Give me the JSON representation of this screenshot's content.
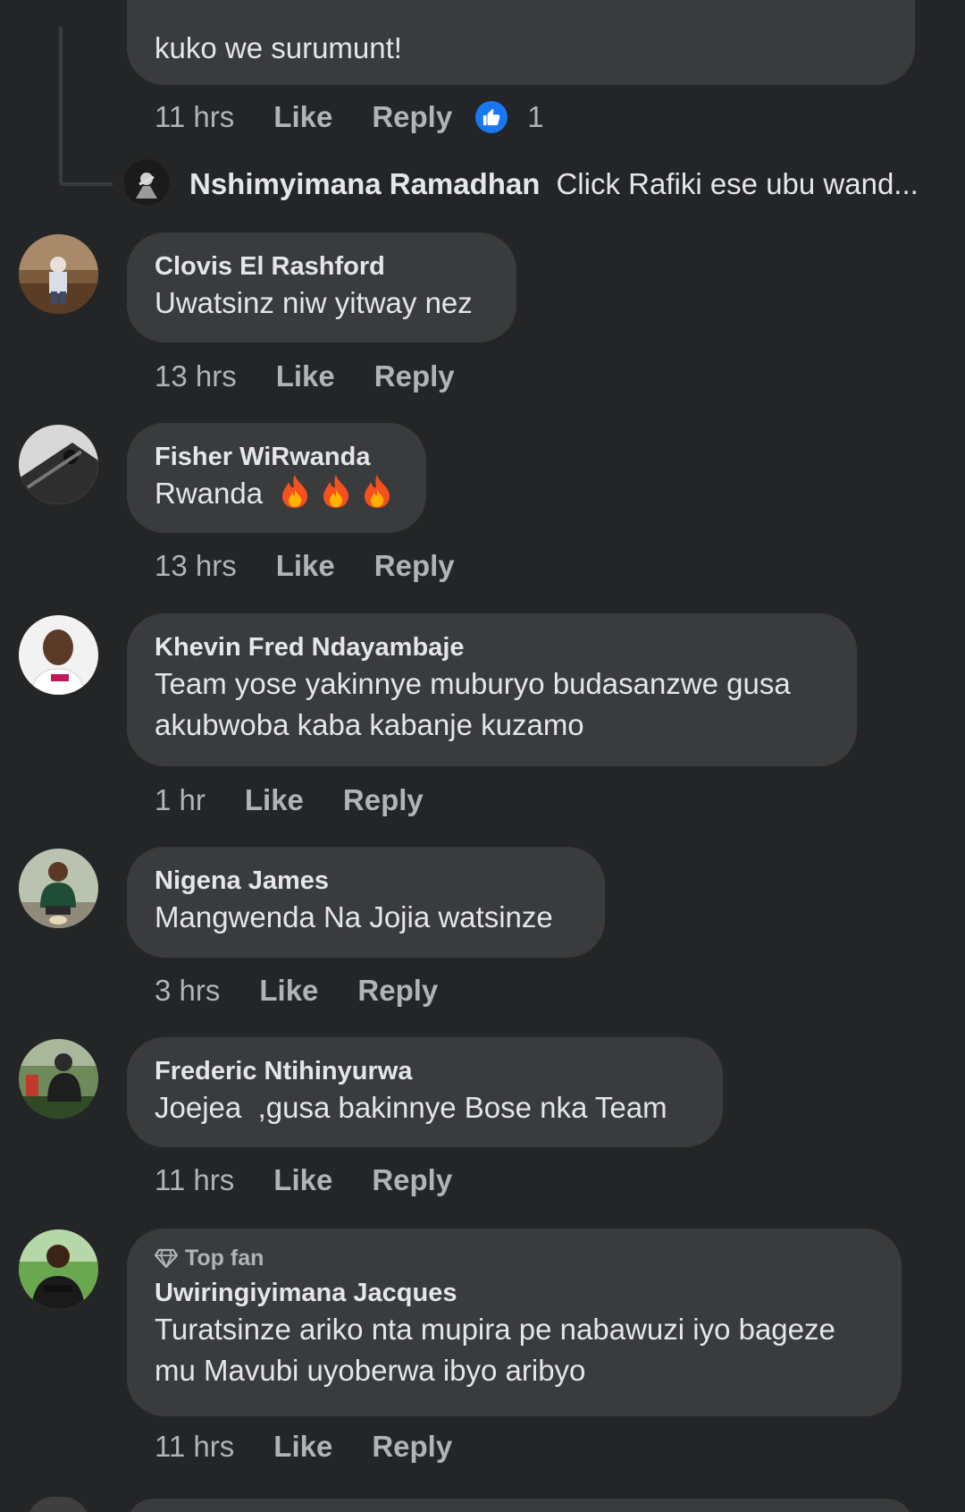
{
  "top_reply": {
    "text": "kuko we surumunt!",
    "time": "11 hrs",
    "like": "Like",
    "reply": "Reply",
    "reaction_count": "1"
  },
  "reply_preview": {
    "author": "Nshimyimana Ramadhan",
    "text": "Click Rafiki ese ubu wand..."
  },
  "comments": [
    {
      "author": "Clovis El Rashford",
      "text": "Uwatsinz niw yitway nez",
      "time": "13 hrs",
      "like": "Like",
      "reply": "Reply"
    },
    {
      "author": "Fisher WiRwanda",
      "text": "Rwanda",
      "emoji": [
        "fire-icon",
        "fire-icon",
        "fire-icon"
      ],
      "time": "13 hrs",
      "like": "Like",
      "reply": "Reply"
    },
    {
      "author": "Khevin Fred Ndayambaje",
      "text_line1": "Team yose yakinnye muburyo budasanzwe gusa",
      "text_line2": "akubwoba kaba kabanje kuzamo",
      "time": "1 hr",
      "like": "Like",
      "reply": "Reply"
    },
    {
      "author": "Nigena James",
      "text": "Mangwenda Na Jojia watsinze",
      "time": "3 hrs",
      "like": "Like",
      "reply": "Reply"
    },
    {
      "author": "Frederic Ntihinyurwa",
      "text": "Joejea  ,gusa bakinnye Bose nka Team",
      "time": "11 hrs",
      "like": "Like",
      "reply": "Reply"
    },
    {
      "badge": "Top fan",
      "author": "Uwiringiyimana Jacques",
      "text_line1": "Turatsinze ariko nta mupira pe nabawuzi iyo bageze",
      "text_line2": "mu Mavubi uyoberwa ibyo aribyo",
      "time": "11 hrs",
      "like": "Like",
      "reply": "Reply"
    }
  ],
  "colors": {
    "background": "#242526",
    "bubble": "#3a3b3c",
    "primary_text": "#e4e6eb",
    "secondary_text": "#b0b3b8",
    "like_blue": "#1877f2"
  }
}
